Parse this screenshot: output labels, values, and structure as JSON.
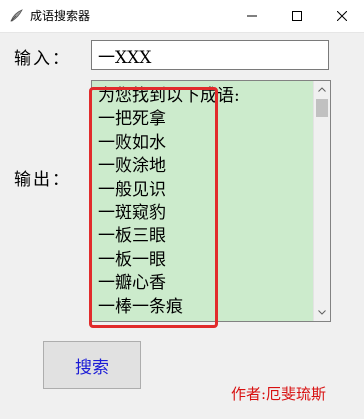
{
  "window": {
    "title": "成语搜索器",
    "icon": "feather-app-icon"
  },
  "form": {
    "input_label": "输入：",
    "input_value": "一XXX",
    "output_label": "输出："
  },
  "output": {
    "background": "#ccebcc",
    "lines": [
      "为您找到以下成语:",
      "一把死拿",
      "一败如水",
      "一败涂地",
      "一般见识",
      "一斑窥豹",
      "一板三眼",
      "一板一眼",
      "一瓣心香",
      "一棒一条痕"
    ]
  },
  "annotation": {
    "highlight_color": "#e12b2b"
  },
  "buttons": {
    "search_label": "搜索"
  },
  "footer": {
    "author": "作者:厄斐琉斯",
    "author_color": "#d81010"
  }
}
